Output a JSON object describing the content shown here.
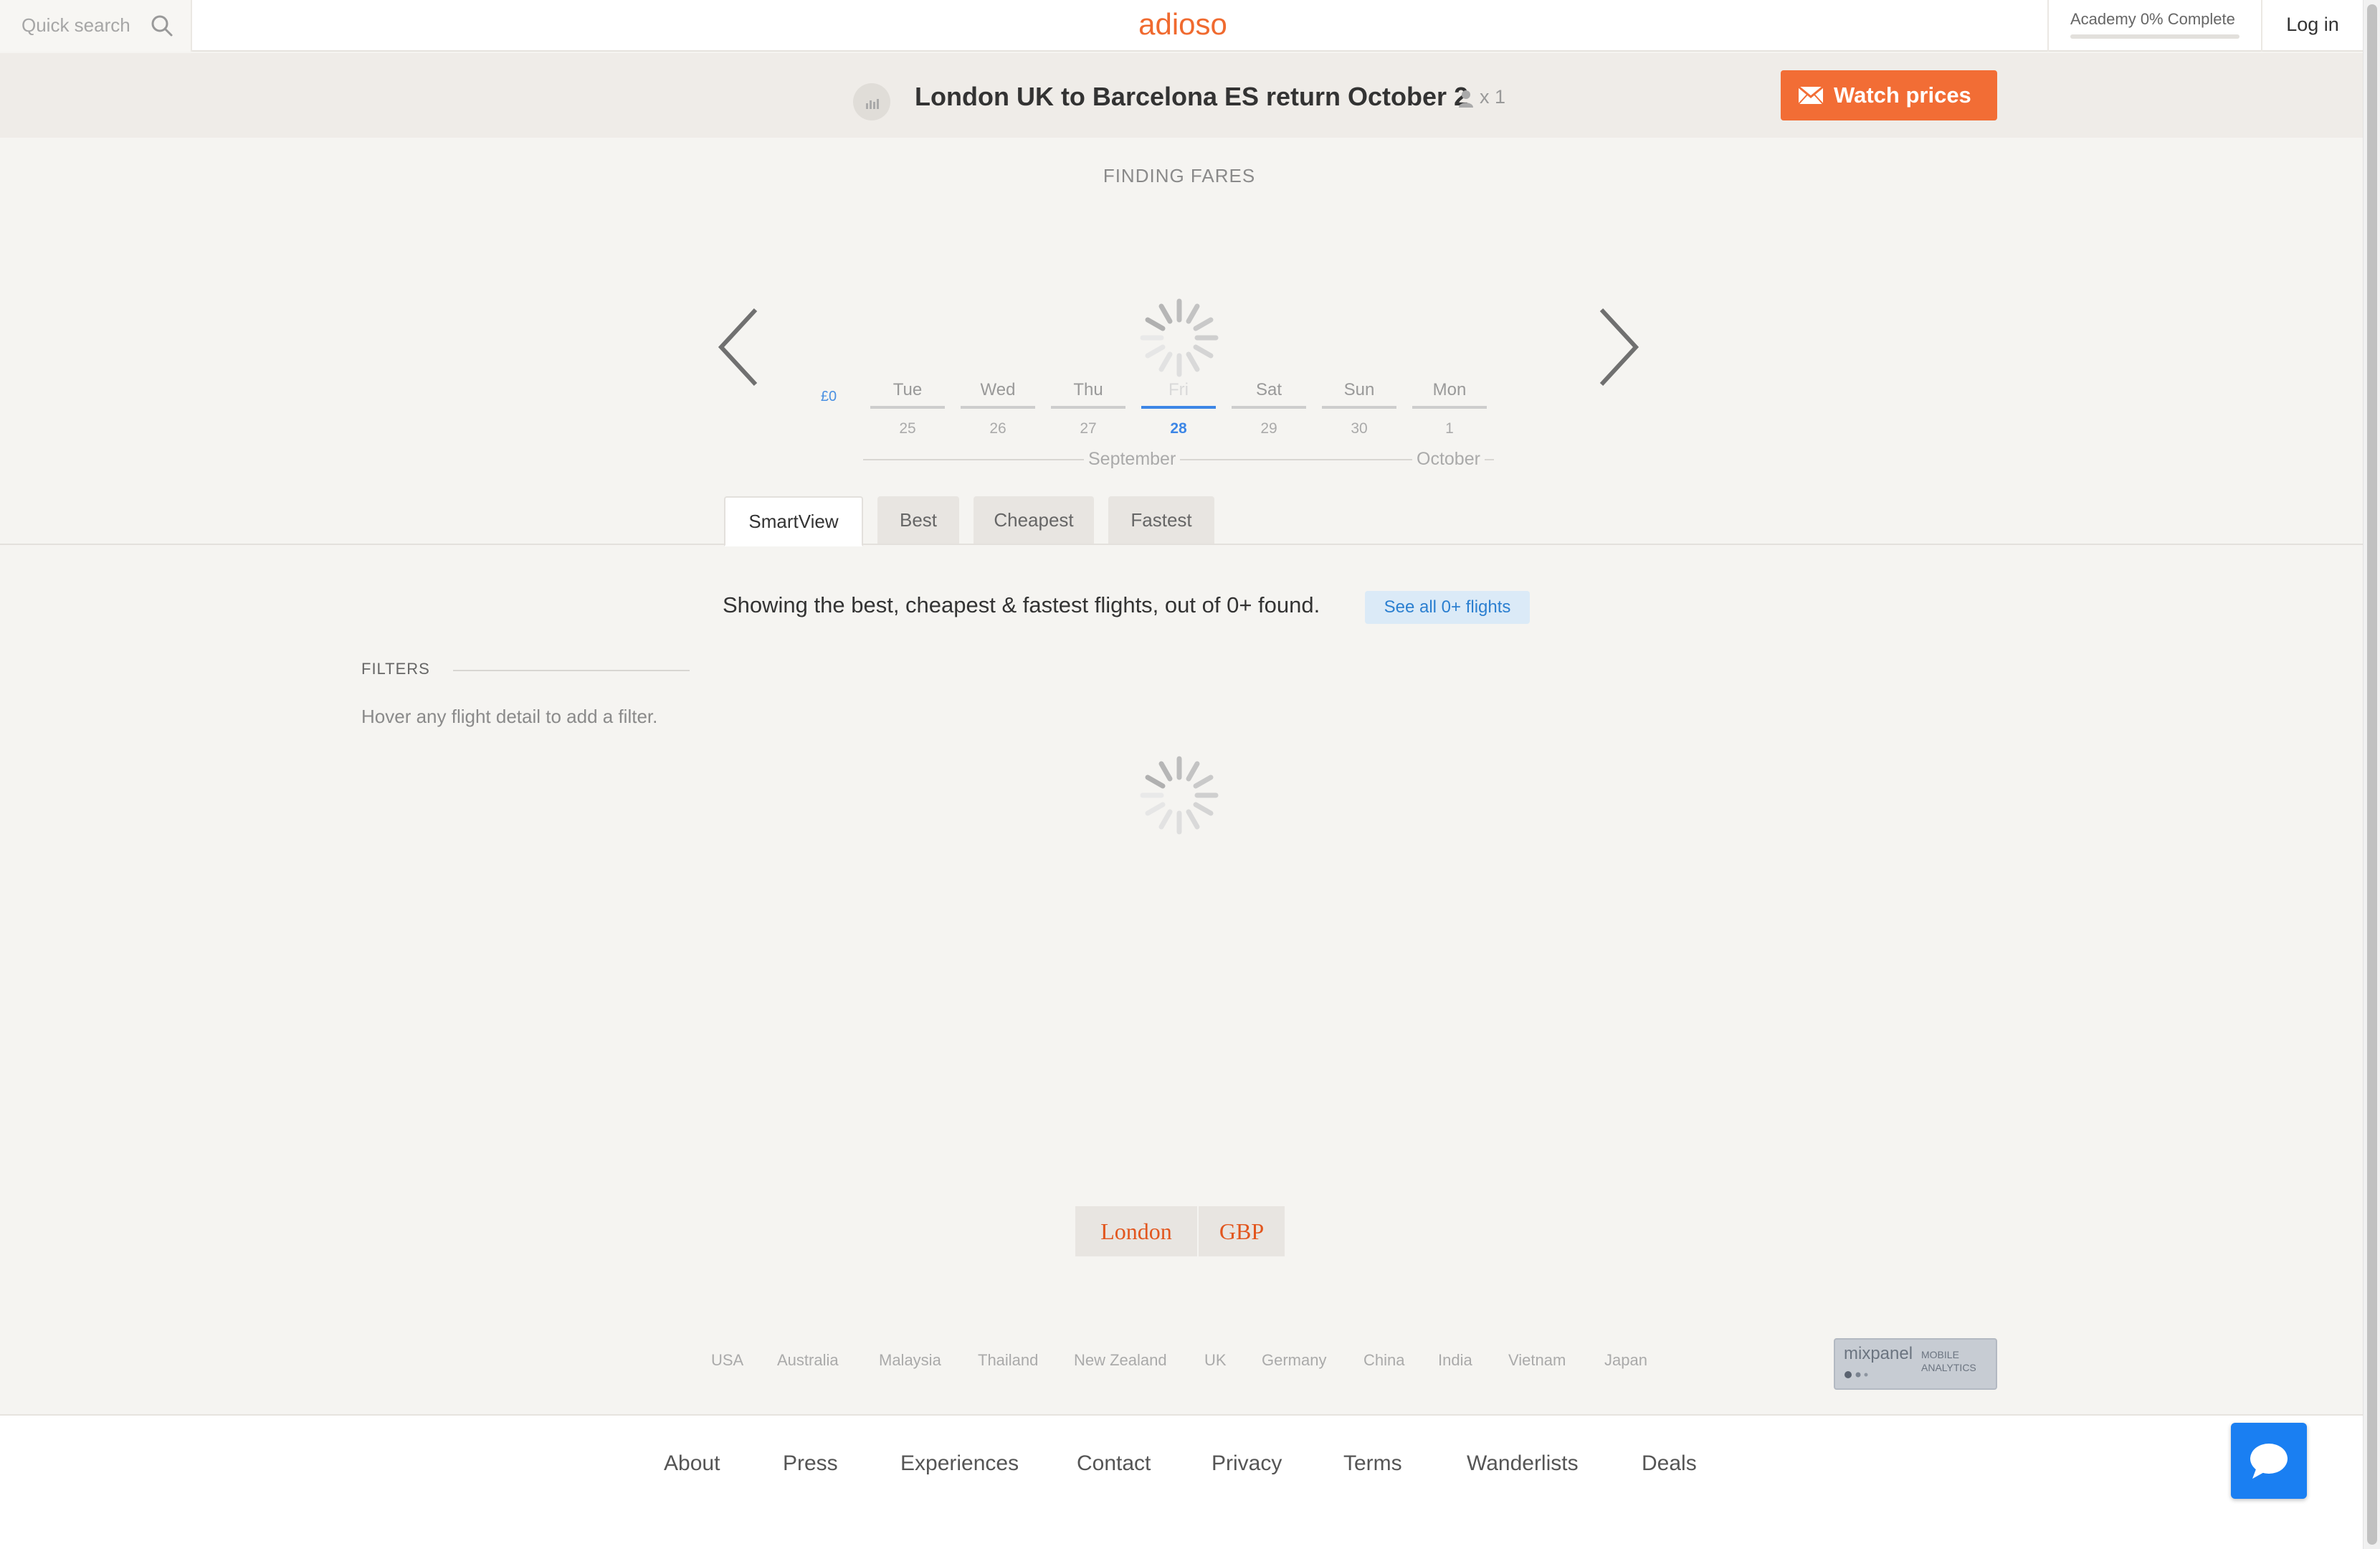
{
  "header": {
    "search_placeholder": "Quick search",
    "logo": "adioso",
    "academy_label": "Academy 0% Complete",
    "academy_progress": 0,
    "login_label": "Log in"
  },
  "route": {
    "title": "London UK to Barcelona ES return October 2",
    "passengers": "x 1",
    "watch_label": "Watch prices"
  },
  "status": {
    "finding": "FINDING FARES"
  },
  "calendar": {
    "price": "£0",
    "days": [
      {
        "name": "Tue",
        "date": "25"
      },
      {
        "name": "Wed",
        "date": "26"
      },
      {
        "name": "Thu",
        "date": "27"
      },
      {
        "name": "Fri",
        "date": "28"
      },
      {
        "name": "Sat",
        "date": "29"
      },
      {
        "name": "Sun",
        "date": "30"
      },
      {
        "name": "Mon",
        "date": "1"
      }
    ],
    "selected_index": 3,
    "months": [
      "September",
      "October"
    ]
  },
  "tabs": [
    "SmartView",
    "Best",
    "Cheapest",
    "Fastest"
  ],
  "active_tab": "SmartView",
  "results": {
    "showing": "Showing the best, cheapest & fastest flights, out of 0+ found.",
    "see_all": "See all 0+ flights"
  },
  "filters": {
    "title": "FILTERS",
    "hint": "Hover any flight detail to add a filter."
  },
  "locale": {
    "city": "London",
    "currency": "GBP"
  },
  "countries": [
    "USA",
    "Australia",
    "Malaysia",
    "Thailand",
    "New Zealand",
    "UK",
    "Germany",
    "China",
    "India",
    "Vietnam",
    "Japan"
  ],
  "badge": {
    "name": "mixpanel",
    "sub1": "MOBILE",
    "sub2": "ANALYTICS"
  },
  "footer": {
    "links": [
      "About",
      "Press",
      "Experiences",
      "Contact",
      "Privacy",
      "Terms",
      "Wanderlists",
      "Deals"
    ]
  },
  "colors": {
    "brand": "#f06a2f",
    "watch_button": "#f26d35",
    "selected_day": "#3d86e6",
    "chat_button": "#1a7ff2"
  },
  "icons": [
    "search-icon",
    "bar-chart-icon",
    "person-icon",
    "envelope-icon",
    "chevron-left-icon",
    "chevron-right-icon",
    "loading-spinner-icon",
    "chat-bubble-icon"
  ]
}
